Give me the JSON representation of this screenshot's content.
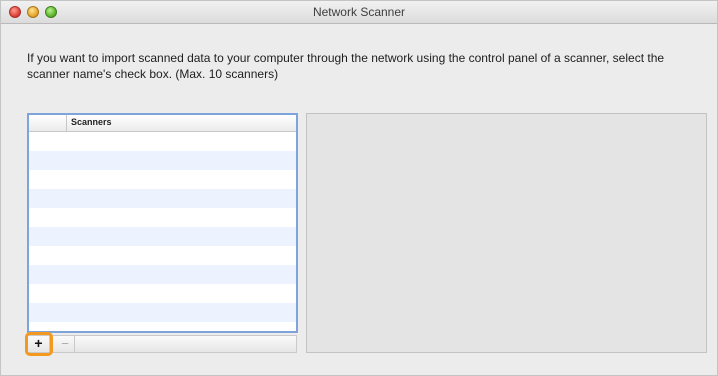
{
  "window": {
    "title": "Network Scanner"
  },
  "instructions": "If you want to import scanned data to your computer through the network using the control panel of a scanner, select the scanner name's check box. (Max. 10 scanners)",
  "scanner_table": {
    "columns": [
      "",
      "Scanners"
    ],
    "rows": []
  },
  "buttons": {
    "add_label": "+",
    "remove_label": "−"
  },
  "colors": {
    "highlight": "#f39a1e",
    "table_focus_border": "#7fa4dc",
    "alternate_row": "#edf3fe"
  }
}
